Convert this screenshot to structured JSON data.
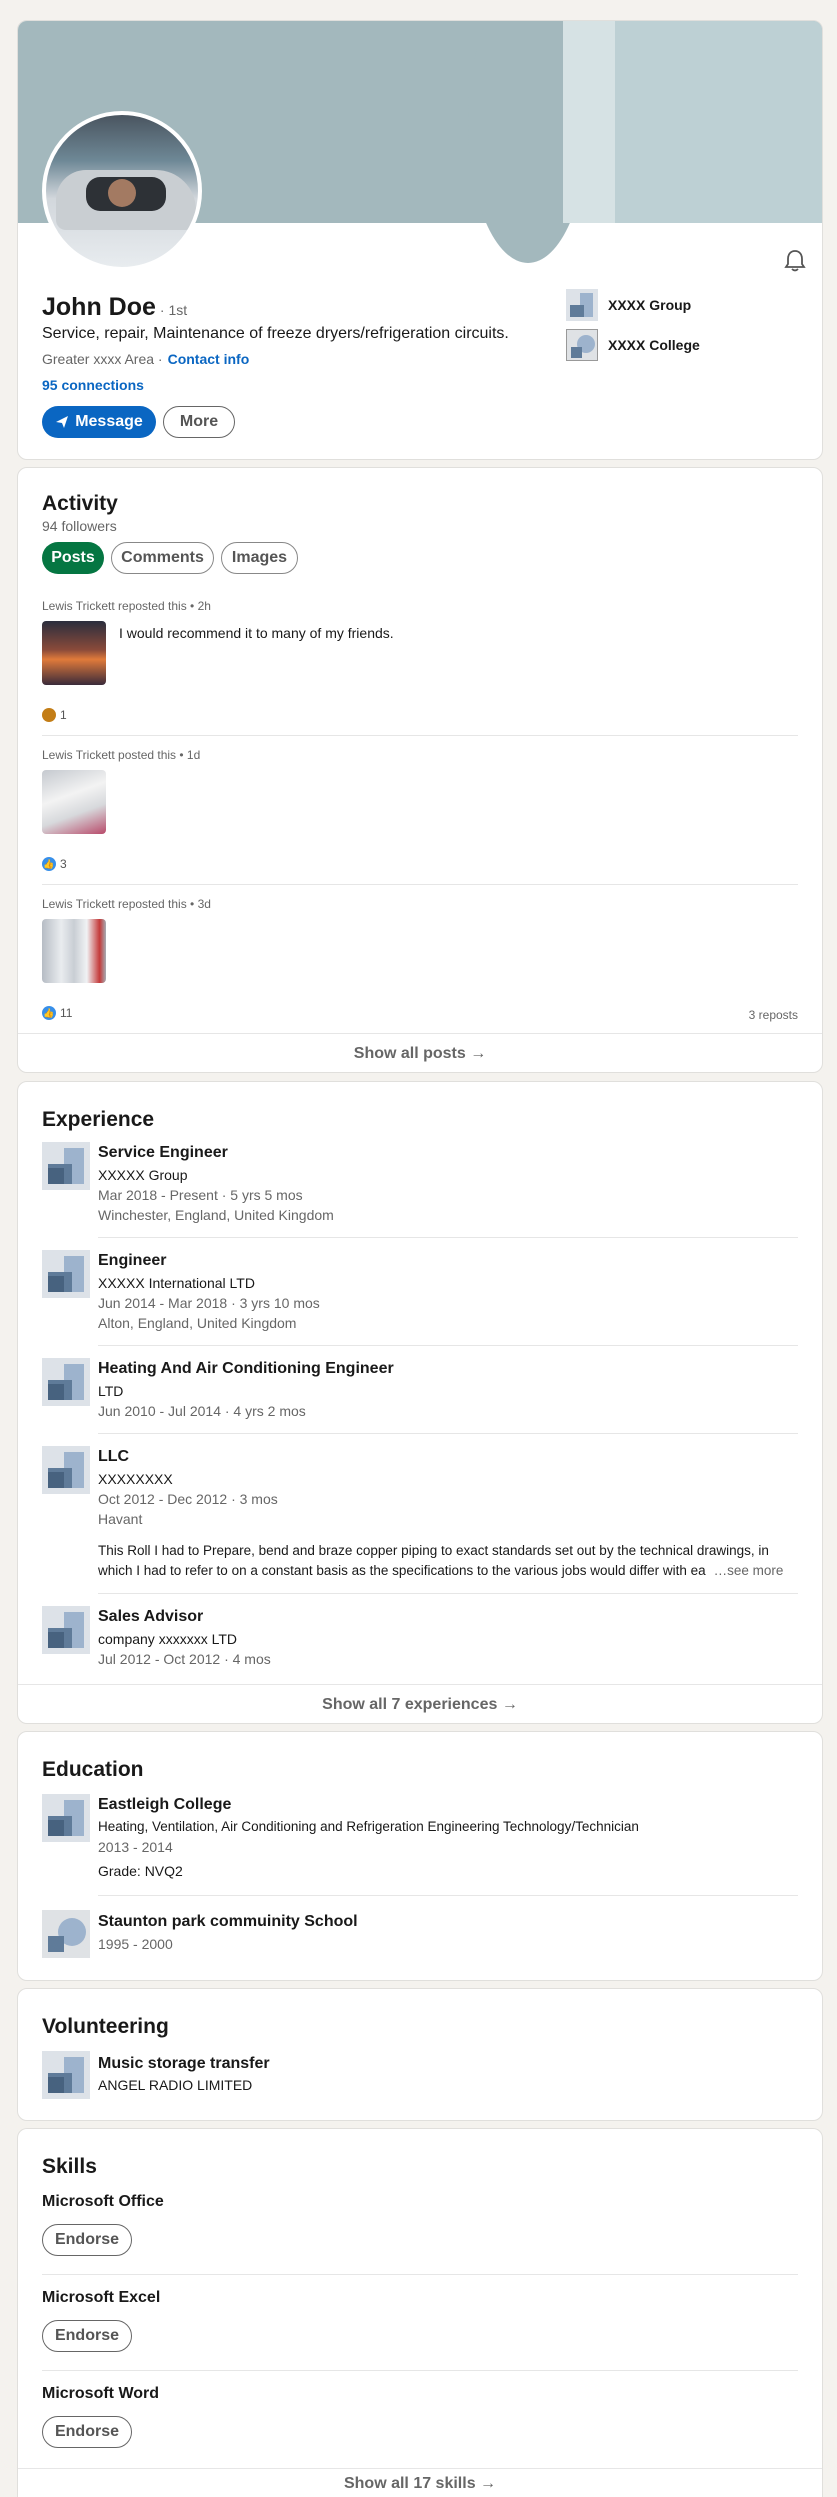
{
  "profile": {
    "name": "John Doe",
    "degree": "· 1st",
    "headline": "Service, repair, Maintenance of freeze dryers/refrigeration circuits.",
    "location": "Greater xxxx Area ·",
    "contact_info": "Contact info",
    "connections": "95 connections",
    "message_label": "Message",
    "more_label": "More",
    "companies": [
      {
        "name": "XXXX Group"
      },
      {
        "name": "XXXX College"
      }
    ],
    "icons": {
      "bell": "bell-icon",
      "send": "paper-plane-icon"
    }
  },
  "activity": {
    "title": "Activity",
    "followers": "94 followers",
    "tabs": [
      "Posts",
      "Comments",
      "Images"
    ],
    "posts": [
      {
        "header": "Lewis Trickett reposted this • 2h",
        "text": "I would recommend it to many of my friends.",
        "reactions": "1",
        "reposts": ""
      },
      {
        "header": "Lewis Trickett posted this • 1d",
        "text": "",
        "reactions": "3",
        "reposts": ""
      },
      {
        "header": "Lewis Trickett reposted this • 3d",
        "text": "",
        "reactions": "11",
        "reposts": "3 reposts"
      }
    ],
    "show_all": "Show all posts →"
  },
  "experience": {
    "title": "Experience",
    "items": [
      {
        "title": "Service Engineer",
        "company": "XXXXX Group",
        "dates": "Mar 2018 - Present · 5 yrs 5 mos",
        "location": "Winchester, England, United Kingdom"
      },
      {
        "title": "Engineer",
        "company": "XXXXX International LTD",
        "dates": "Jun 2014 - Mar 2018 · 3 yrs 10 mos",
        "location": "Alton, England, United Kingdom"
      },
      {
        "title": "Heating And Air Conditioning Engineer",
        "company": "LTD",
        "dates": "Jun 2010 - Jul 2014 · 4 yrs 2 mos",
        "location": ""
      },
      {
        "title": "LLC",
        "company": "XXXXXXXX",
        "dates": "Oct 2012 - Dec 2012 · 3 mos",
        "location": "Havant",
        "description_1": "This Roll I had to Prepare, bend and braze copper piping to exact standards set out by the technical drawings, in",
        "description_2": "which I had to refer to on a constant basis as the specifications to the various jobs would differ with ea",
        "see_more": "…see more"
      },
      {
        "title": "Sales Advisor",
        "company": "company xxxxxxx LTD",
        "dates": "Jul 2012 - Oct 2012 · 4 mos",
        "location": ""
      }
    ],
    "show_all": "Show all 7 experiences →"
  },
  "education": {
    "title": "Education",
    "items": [
      {
        "school": "Eastleigh College",
        "degree": "Heating, Ventilation, Air Conditioning and Refrigeration Engineering Technology/Technician",
        "dates": "2013 - 2014",
        "grade": "Grade: NVQ2"
      },
      {
        "school": "Staunton park commuinity School",
        "dates": "1995 - 2000"
      }
    ]
  },
  "volunteering": {
    "title": "Volunteering",
    "items": [
      {
        "role": "Music storage transfer",
        "org": "ANGEL RADIO LIMITED"
      }
    ]
  },
  "skills": {
    "title": "Skills",
    "items": [
      {
        "name": "Microsoft Office"
      },
      {
        "name": "Microsoft Excel"
      },
      {
        "name": "Microsoft Word"
      }
    ],
    "endorse_label": "Endorse",
    "show_all": "Show all 17 skills →"
  },
  "colors": {
    "primary_blue": "#0a66c2",
    "active_tab_green": "#057642",
    "banner": "#a3b8bd"
  }
}
